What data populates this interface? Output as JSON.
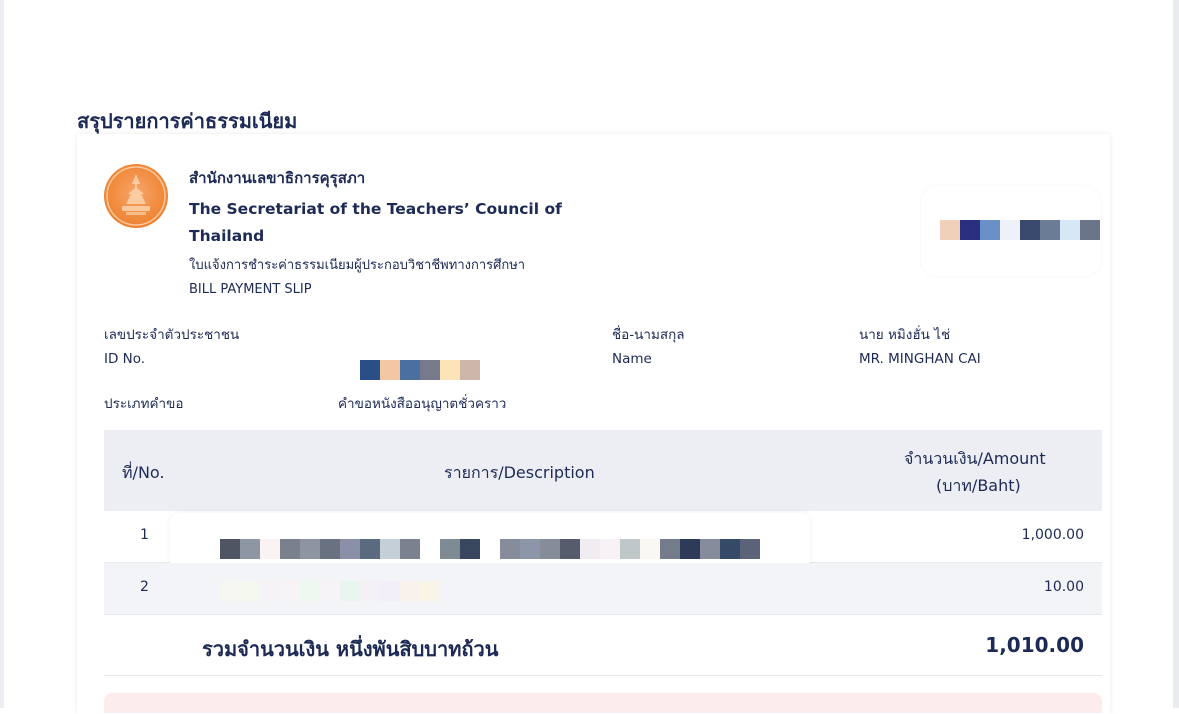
{
  "page": {
    "title": "สรุปรายการค่าธรรมเนียม"
  },
  "header": {
    "org_th": "สำนักงานเลขาธิการคุรุสภา",
    "org_en": "The Secretariat of the Teachers’ Council of Thailand",
    "slip_th": "ใบแจ้งการชำระค่าธรรมเนียมผู้ประกอบวิชาชีพทางการศึกษา",
    "slip_en": "BILL PAYMENT SLIP"
  },
  "info": {
    "id_label_th": "เลขประจำตัวประชาชน",
    "id_label_en": "ID No.",
    "name_label_th": "ชื่อ-นามสกุล",
    "name_label_en": "Name",
    "name_th": "นาย หมิงฮั่น ไช่",
    "name_en": "MR. MINGHAN CAI",
    "type_label": "ประเภทคำขอ",
    "type_value": "คำขอหนังสืออนุญาตชั่วคราว"
  },
  "table": {
    "col_no": "ที่/No.",
    "col_desc": "รายการ/Description",
    "col_amount_line1": "จำนวนเงิน/Amount",
    "col_amount_line2": "(บาท/Baht)",
    "rows": [
      {
        "no": "1",
        "amount": "1,000.00"
      },
      {
        "no": "2",
        "amount": "10.00"
      }
    ],
    "total_label": "รวมจำนวนเงิน หนึ่งพันสิบบาทถ้วน",
    "total_amount": "1,010.00"
  },
  "colors": {
    "primary_text": "#1d2a55",
    "seal_orange": "#f08a3c",
    "header_bg": "#eceef4",
    "alt_row_bg": "#f3f4f8",
    "alert_bg": "#fdecec"
  },
  "icons": {
    "seal": "teachers-council-seal-icon"
  }
}
